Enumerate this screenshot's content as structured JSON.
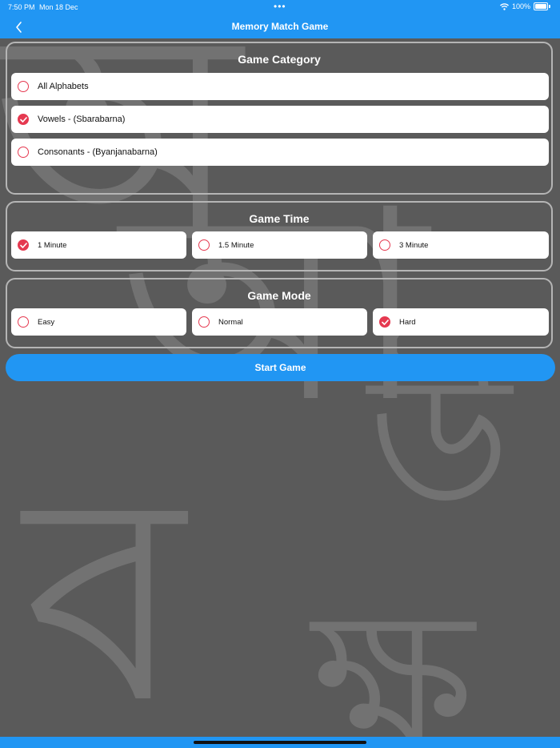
{
  "status_bar": {
    "time": "7:50 PM",
    "date": "Mon 18 Dec",
    "battery": "100%"
  },
  "nav": {
    "title": "Memory Match Game",
    "back_icon": "chevron-left-icon"
  },
  "colors": {
    "primary": "#2196f3",
    "accent": "#e53950",
    "background": "#5a5a5a"
  },
  "game_category": {
    "title": "Game Category",
    "options": [
      {
        "label": "All Alphabets",
        "selected": false
      },
      {
        "label": "Vowels - (Sbarabarna)",
        "selected": true
      },
      {
        "label": "Consonants - (Byanjanabarna)",
        "selected": false
      }
    ]
  },
  "game_time": {
    "title": "Game Time",
    "options": [
      {
        "label": "1 Minute",
        "selected": true
      },
      {
        "label": "1.5 Minute",
        "selected": false
      },
      {
        "label": "3 Minute",
        "selected": false
      }
    ]
  },
  "game_mode": {
    "title": "Game Mode",
    "options": [
      {
        "label": "Easy",
        "selected": false
      },
      {
        "label": "Normal",
        "selected": false
      },
      {
        "label": "Hard",
        "selected": true
      }
    ]
  },
  "start_button": {
    "label": "Start Game"
  },
  "background_letters": [
    "অ",
    "আ",
    "উ",
    "ব",
    "ক্ষ"
  ]
}
